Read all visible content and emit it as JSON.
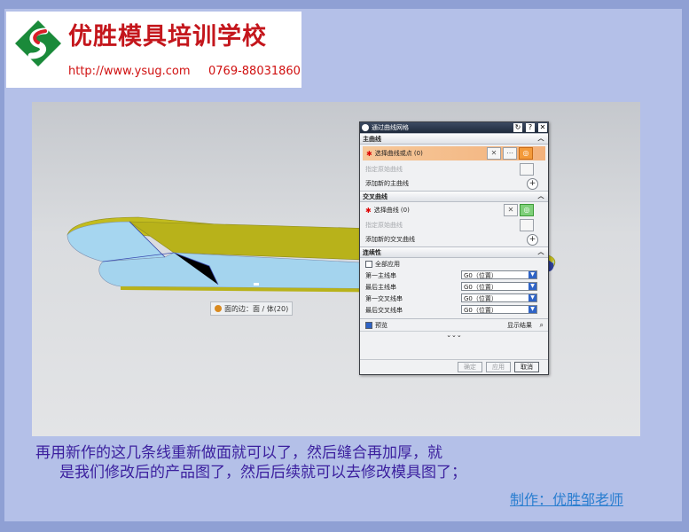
{
  "logo": {
    "title": "优胜模具培训学校",
    "url": "http://www.ysug.com",
    "phone": "0769-88031860"
  },
  "cad": {
    "face_label": "面的边：面 / 体(20)",
    "dialog": {
      "title": "通过曲线网格",
      "title_buttons": [
        "↻",
        "?",
        "✕"
      ],
      "sections": {
        "primary": {
          "header": "主曲线",
          "select_label": "选择曲线或点 (0)",
          "specify_label": "指定原始曲线",
          "add_label": "添加新的主曲线"
        },
        "cross": {
          "header": "交叉曲线",
          "select_label": "选择曲线 (0)",
          "specify_label": "指定原始曲线",
          "add_label": "添加新的交叉曲线"
        },
        "continuity": {
          "header": "连续性",
          "apply_all_label": "全部应用",
          "rows": [
            {
              "label": "第一主线串",
              "value": "G0（位置）"
            },
            {
              "label": "最后主线串",
              "value": "G0（位置）"
            },
            {
              "label": "第一交叉线串",
              "value": "G0（位置）"
            },
            {
              "label": "最后交叉线串",
              "value": "G0（位置）"
            }
          ]
        }
      },
      "preview_label": "预览",
      "preview_checked": true,
      "show_result_label": "显示结果",
      "buttons": {
        "ok": "确定",
        "apply": "应用",
        "cancel": "取消"
      }
    }
  },
  "caption": {
    "line1": "再用新作的这几条线重新做面就可以了，然后缝合再加厚，就",
    "line2": "是我们修改后的产品图了，然后后续就可以去修改模具图了；"
  },
  "author": "制作：优胜邹老师",
  "colors": {
    "slide_bg": "#b4c0e8",
    "logo_red": "#c4161c",
    "caption": "#3b1f9e",
    "author_link": "#2a7ed0",
    "dialog_title": "#2b364b",
    "select_row": "#f3b27c"
  }
}
